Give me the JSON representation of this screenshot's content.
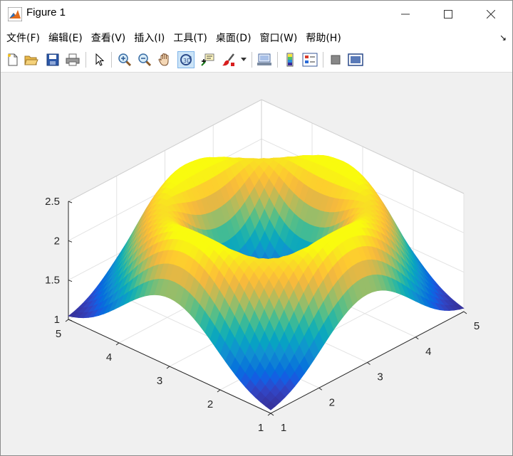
{
  "window": {
    "title": "Figure 1"
  },
  "menu": {
    "items": [
      "文件(F)",
      "编辑(E)",
      "查看(V)",
      "插入(I)",
      "工具(T)",
      "桌面(D)",
      "窗口(W)",
      "帮助(H)"
    ]
  },
  "toolbar": {
    "buttons": [
      {
        "name": "new-figure-icon"
      },
      {
        "name": "open-file-icon"
      },
      {
        "name": "save-icon"
      },
      {
        "name": "print-icon"
      },
      {
        "name": "select-arrow-icon"
      },
      {
        "name": "zoom-in-icon"
      },
      {
        "name": "zoom-out-icon"
      },
      {
        "name": "pan-hand-icon"
      },
      {
        "name": "rotate-3d-icon",
        "active": true
      },
      {
        "name": "data-cursor-icon"
      },
      {
        "name": "brush-icon"
      },
      {
        "name": "link-plot-icon"
      },
      {
        "name": "colorbar-icon"
      },
      {
        "name": "legend-icon"
      },
      {
        "name": "hide-plot-tools-icon"
      },
      {
        "name": "show-plot-tools-icon"
      }
    ]
  },
  "chart_data": {
    "type": "surface",
    "z_function": "2 * exp(-(r - 1.5)^2 / 0.8) + 1 approx, ring of radius ~1.5 centered at (3,3)",
    "xlim": [
      1,
      5
    ],
    "ylim": [
      1,
      5
    ],
    "zlim": [
      1,
      2.5
    ],
    "x_ticks": [
      "1",
      "2",
      "3",
      "4",
      "5"
    ],
    "y_ticks": [
      "1",
      "2",
      "3",
      "4",
      "5"
    ],
    "z_ticks": [
      "1",
      "1.5",
      "2",
      "2.5"
    ],
    "colormap": "parula",
    "grid": true
  }
}
